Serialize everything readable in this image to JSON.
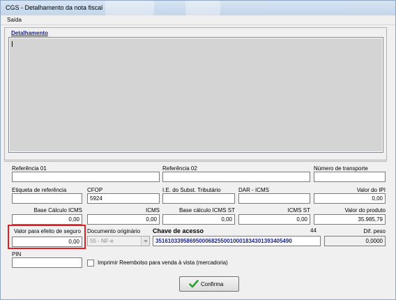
{
  "window": {
    "title": "CGS - Detalhamento da nota fiscal"
  },
  "menu": {
    "items": [
      {
        "label": "Saída"
      }
    ]
  },
  "detail": {
    "legend": "Detalhamento"
  },
  "fields": {
    "referencia01": {
      "label": "Referência 01",
      "value": ""
    },
    "referencia02": {
      "label": "Referência 02",
      "value": ""
    },
    "numero_transporte": {
      "label": "Número de transporte",
      "value": ""
    },
    "etiqueta": {
      "label": "Etiqueta de referência",
      "value": ""
    },
    "cfop": {
      "label": "CFOP",
      "value": "5924"
    },
    "ie_subst": {
      "label": "I.E. do Subst. Tributário",
      "value": ""
    },
    "dar_icms": {
      "label": "DAR - ICMS",
      "value": ""
    },
    "valor_ipi": {
      "label": "Valor do IPI",
      "value": "0,00"
    },
    "base_icms": {
      "label": "Base Cálculo ICMS",
      "value": "0,00"
    },
    "icms": {
      "label": "ICMS",
      "value": "0,00"
    },
    "base_icms_st": {
      "label": "Base cálculo ICMS ST",
      "value": "0,00"
    },
    "icms_st": {
      "label": "ICMS ST",
      "value": "0,00"
    },
    "valor_produto": {
      "label": "Valor do produto",
      "value": "35.985,79"
    },
    "valor_seguro": {
      "label": "Valor para efeito de seguro",
      "value": "0,00"
    },
    "documento_originario": {
      "label": "Documento originário",
      "value": "55 - NF-e"
    },
    "chave_acesso": {
      "label": "Chave de acesso",
      "count": "44",
      "value": "35161033958695000682550010001834301393405490"
    },
    "dif_peso": {
      "label": "Dif. peso",
      "value": "0,0000"
    },
    "pin": {
      "label": "PIN",
      "value": ""
    }
  },
  "checkbox": {
    "label": "Imprimir Reembolso para venda à vista (mercadoria)",
    "checked": false
  },
  "buttons": {
    "confirm": "Confirma"
  },
  "colors": {
    "key_text": "#1a237e",
    "highlight": "#e02020",
    "confirm_icon": "#2e9e2e"
  }
}
